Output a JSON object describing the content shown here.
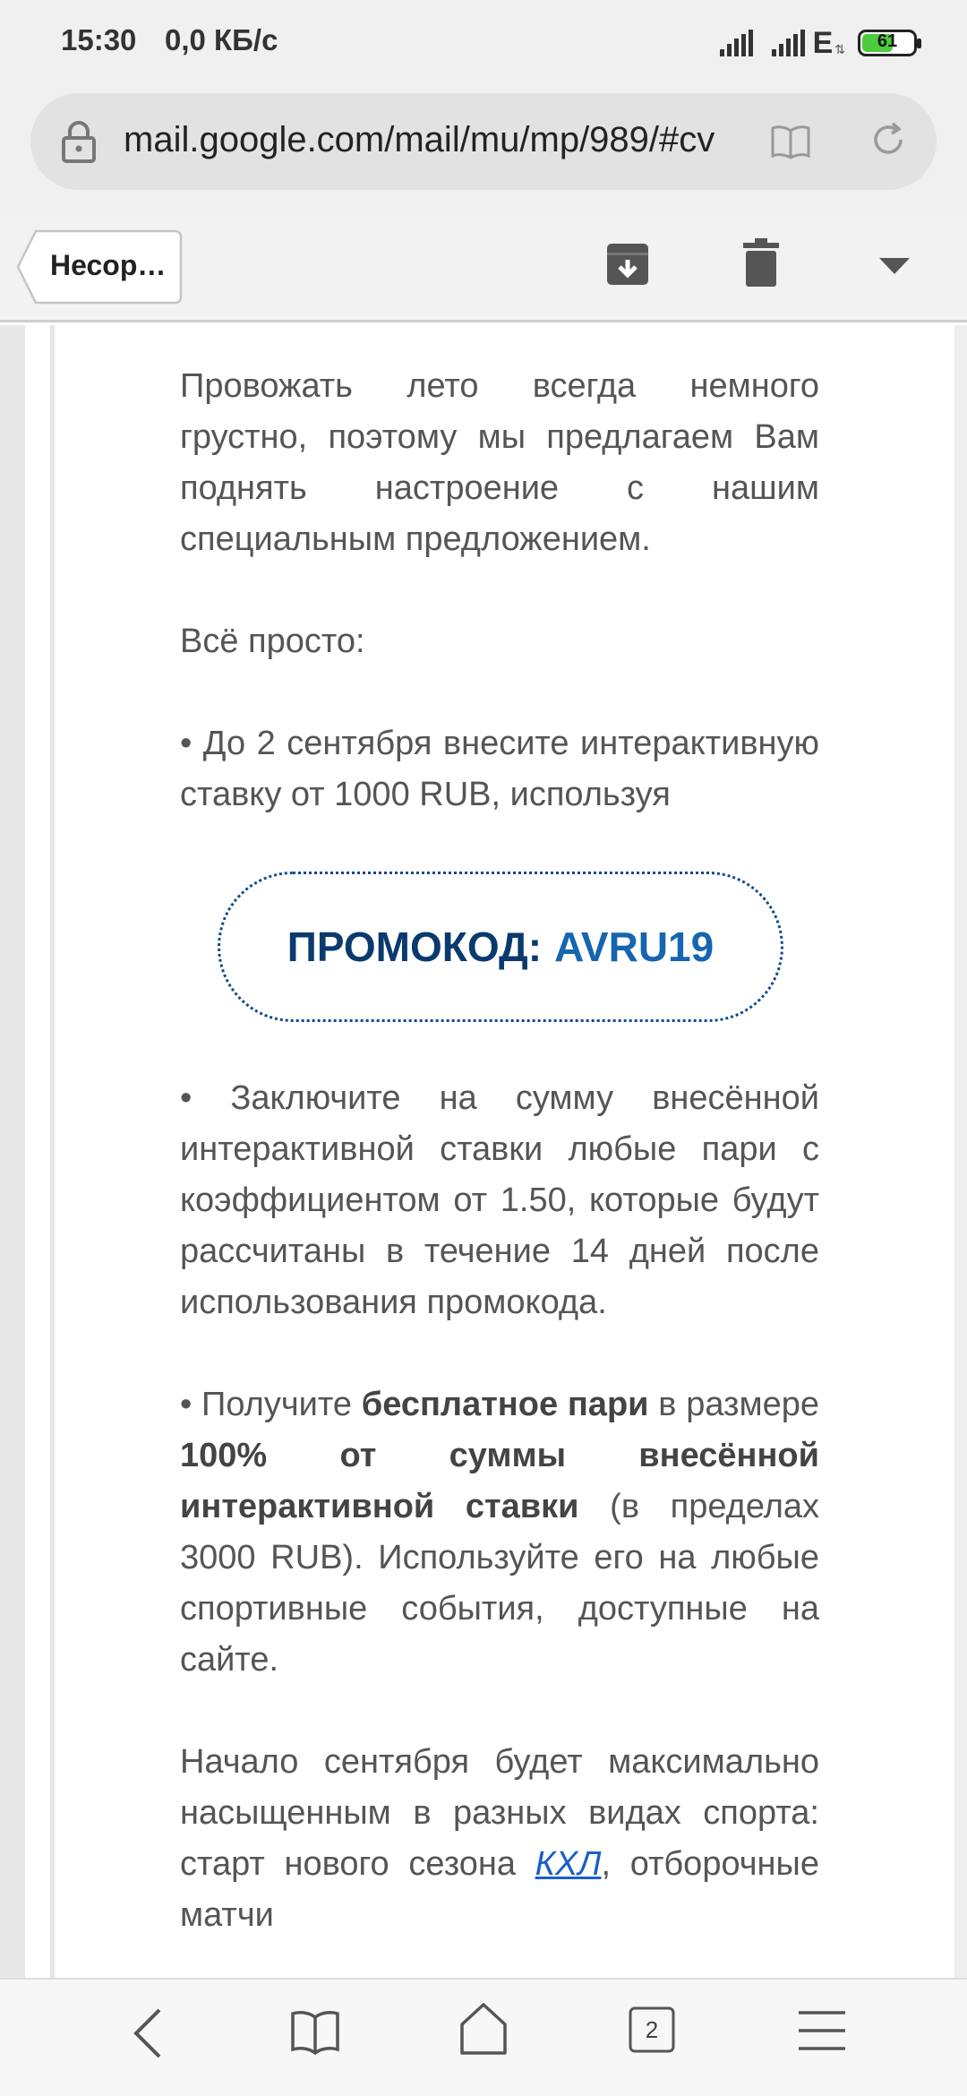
{
  "status_bar": {
    "time": "15:30",
    "network_speed": "0,0 КБ/с",
    "network_type": "E",
    "battery": "61"
  },
  "browser": {
    "url": "mail.google.com/mail/mu/mp/989/#cv",
    "tabs_count": "2"
  },
  "toolbar": {
    "back_label": "Несор…"
  },
  "email": {
    "p1": "Провожать лето всегда немного грустно, поэтому мы предлагаем Вам поднять настроение с нашим специальным предложением.",
    "p2": "Всё просто:",
    "p3": "•  До 2 сентября внесите интерактивную ставку от 1000 RUB, используя",
    "promo_label": "ПРОМОКОД:",
    "promo_code": "AVRU19",
    "p4": "• Заключите на сумму внесённой интерактивной ставки любые пари с коэффициентом от 1.50, которые будут рассчитаны в течение 14 дней после использования промокода.",
    "p5_a": "•  Получите ",
    "p5_b": "бесплатное пари",
    "p5_c": " в размере ",
    "p5_d": "100% от суммы внесённой интерактивной ставки",
    "p5_e": " (в пределах 3000 RUB). Используйте его на любые спортивные события, доступные на сайте.",
    "p6_a": "Начало сентября будет максимально насыщенным в разных видах спорта: старт нового сезона ",
    "p6_link": "КХЛ",
    "p6_b": ", отборочные матчи"
  },
  "colors": {
    "promo_border": "#0d4b8c",
    "promo_label": "#0a3a6e",
    "promo_code": "#1565b0",
    "link": "#1a5fc8",
    "battery_fill": "#4ccc3c"
  },
  "icons": {
    "lock": "lock-icon",
    "reader": "reader-mode-icon",
    "reload": "reload-icon",
    "archive": "archive-icon",
    "trash": "trash-icon",
    "dropdown": "dropdown-icon",
    "back": "back-icon",
    "bookmarks": "bookmarks-icon",
    "home": "home-icon",
    "tabs": "tabs-icon",
    "menu": "menu-icon"
  }
}
